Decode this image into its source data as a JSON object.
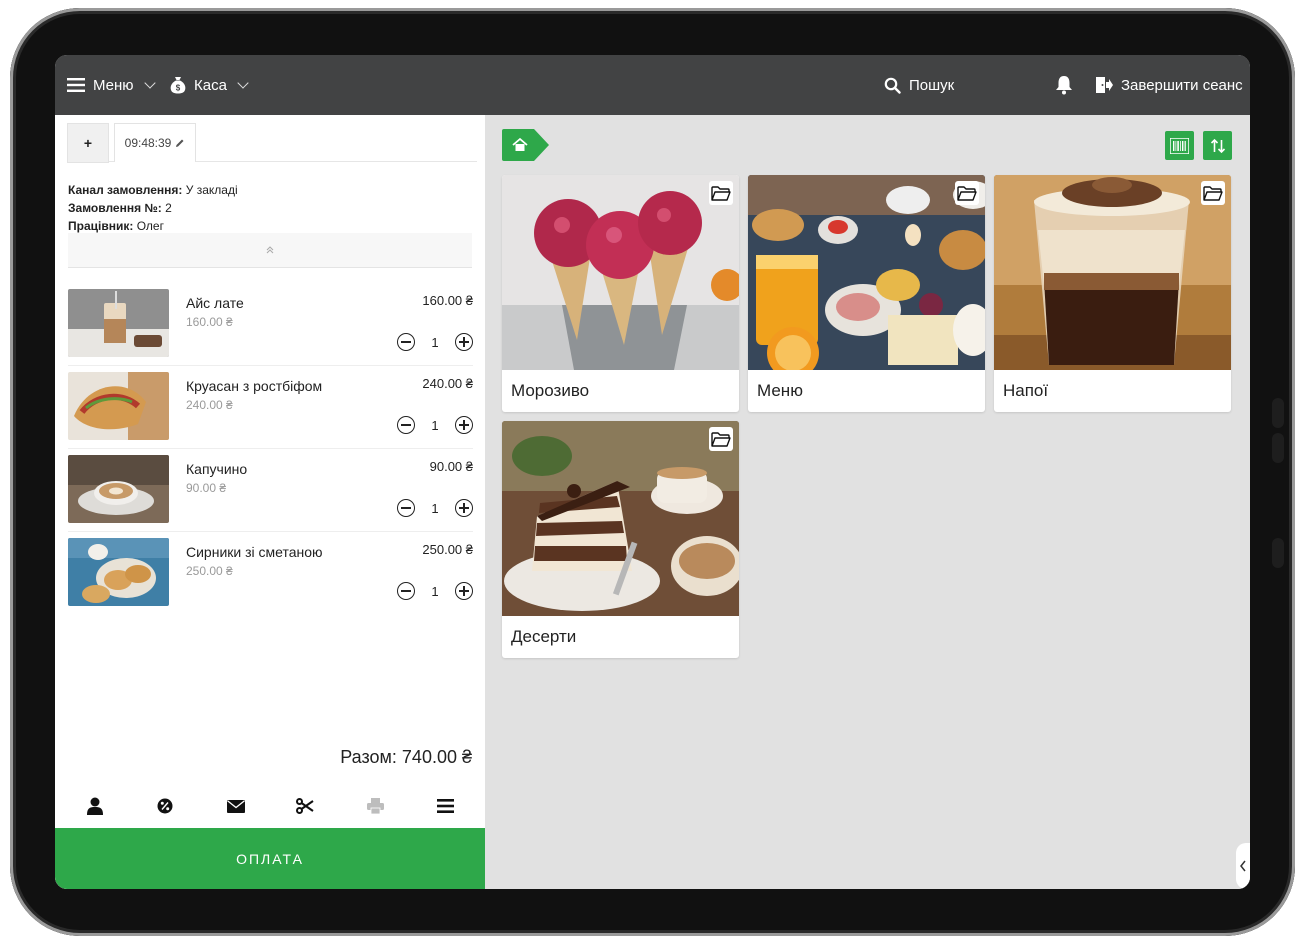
{
  "topbar": {
    "menu_label": "Меню",
    "kasa_label": "Каса",
    "search_label": "Пошук",
    "logout_label": "Завершити сеанс"
  },
  "order": {
    "add_tab": "+",
    "tab_time": "09:48:39",
    "channel_label": "Канал замовлення:",
    "channel_value": "У закладі",
    "number_label": "Замовлення №:",
    "number_value": "2",
    "worker_label": "Працівник:",
    "worker_value": "Олег",
    "items": [
      {
        "name": "Айс лате",
        "unit_price": "160.00 ₴",
        "line_total": "160.00 ₴",
        "qty": "1"
      },
      {
        "name": "Круасан з ростбіфом",
        "unit_price": "240.00 ₴",
        "line_total": "240.00 ₴",
        "qty": "1"
      },
      {
        "name": "Капучино",
        "unit_price": "90.00 ₴",
        "line_total": "90.00 ₴",
        "qty": "1"
      },
      {
        "name": "Сирники зі сметаною",
        "unit_price": "250.00 ₴",
        "line_total": "250.00 ₴",
        "qty": "1"
      }
    ],
    "total": "Разом: 740.00 ₴",
    "pay_label": "ОПЛАТА"
  },
  "categories": [
    {
      "name": "Морозиво"
    },
    {
      "name": "Меню"
    },
    {
      "name": "Напої"
    },
    {
      "name": "Десерти"
    }
  ],
  "colors": {
    "accent": "#2ea84a",
    "topbar": "#424344",
    "catalog_bg": "#e1e1e1"
  }
}
